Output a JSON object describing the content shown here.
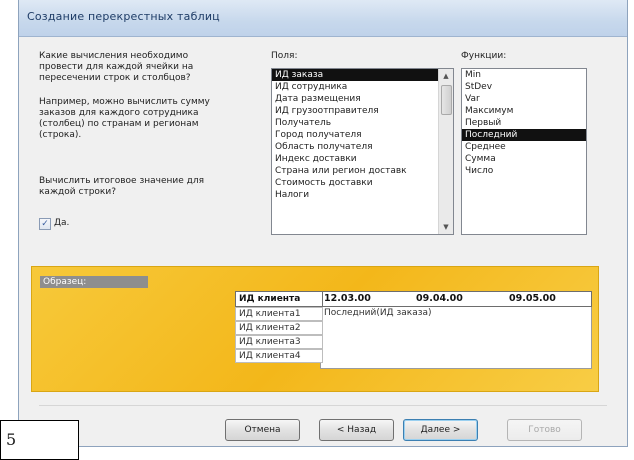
{
  "window": {
    "title": "Создание перекрестных таблиц"
  },
  "question": {
    "p1": "Какие вычисления необходимо провести для каждой ячейки на пересечении строк и столбцов?",
    "p2": "Например, можно вычислить сумму заказов для каждого сотрудника (столбец) по странам и регионам (строка).",
    "p3": "Вычислить итоговое значение для каждой строки?",
    "checkbox_label": "Да.",
    "checkbox_checked": true
  },
  "fields": {
    "label": "Поля:",
    "items": [
      "ИД заказа",
      "ИД сотрудника",
      "Дата размещения",
      "ИД грузоотправителя",
      "Получатель",
      "Город получателя",
      "Область получателя",
      "Индекс доставки",
      "Страна или регион доставк",
      "Стоимость доставки",
      "Налоги"
    ],
    "selected": "ИД заказа"
  },
  "functions": {
    "label": "Функции:",
    "items": [
      "Min",
      "StDev",
      "Var",
      "Максимум",
      "Первый",
      "Последний",
      "Среднее",
      "Сумма",
      "Число"
    ],
    "selected": "Последний"
  },
  "sample": {
    "label": "Образец:",
    "row_header": "ИД клиента",
    "columns": [
      "12.03.00",
      "09.04.00",
      "09.05.00"
    ],
    "rows": [
      "ИД клиента1",
      "ИД клиента2",
      "ИД клиента3",
      "ИД клиента4"
    ],
    "value": "Последний(ИД заказа)"
  },
  "buttons": {
    "cancel": "Отмена",
    "back": "< Назад",
    "next": "Далее >",
    "finish": "Готово"
  },
  "page_number": "5"
}
